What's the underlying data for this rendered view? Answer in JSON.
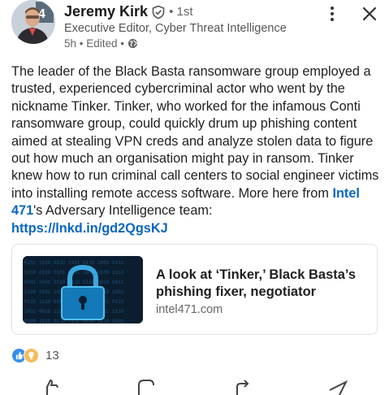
{
  "post": {
    "author_name": "Jeremy Kirk",
    "connection_degree": "• 1st",
    "author_headline": "Executive Editor, Cyber Threat Intelligence",
    "time_meta": "5h • Edited •",
    "body_part1": "The leader of the Black Basta ransomware group employed a trusted, experienced cybercriminal actor who went by the nickname Tinker. Tinker, who worked for the infamous Conti ransomware group, could quickly drum up phishing content aimed at stealing VPN creds and analyze stolen data to figure out how much an organisation might pay in ransom. Tinker knew how to run criminal call centers to social engineer victims into installing remote access software. More here from ",
    "mention": "Intel 471",
    "body_part2": "'s Adversary Intelligence team:",
    "link": "https://lnkd.in/gd2QgsKJ"
  },
  "card": {
    "title": "A look at ‘Tinker,’ Black Basta’s phishing fixer, negotiator",
    "source": "intel471.com"
  },
  "reactions": {
    "count": "13",
    "icons": [
      "like-icon",
      "insightful-icon"
    ]
  },
  "colors": {
    "link": "#0a66c2",
    "like": "#378fe9",
    "insightful": "#f5bb5c"
  }
}
